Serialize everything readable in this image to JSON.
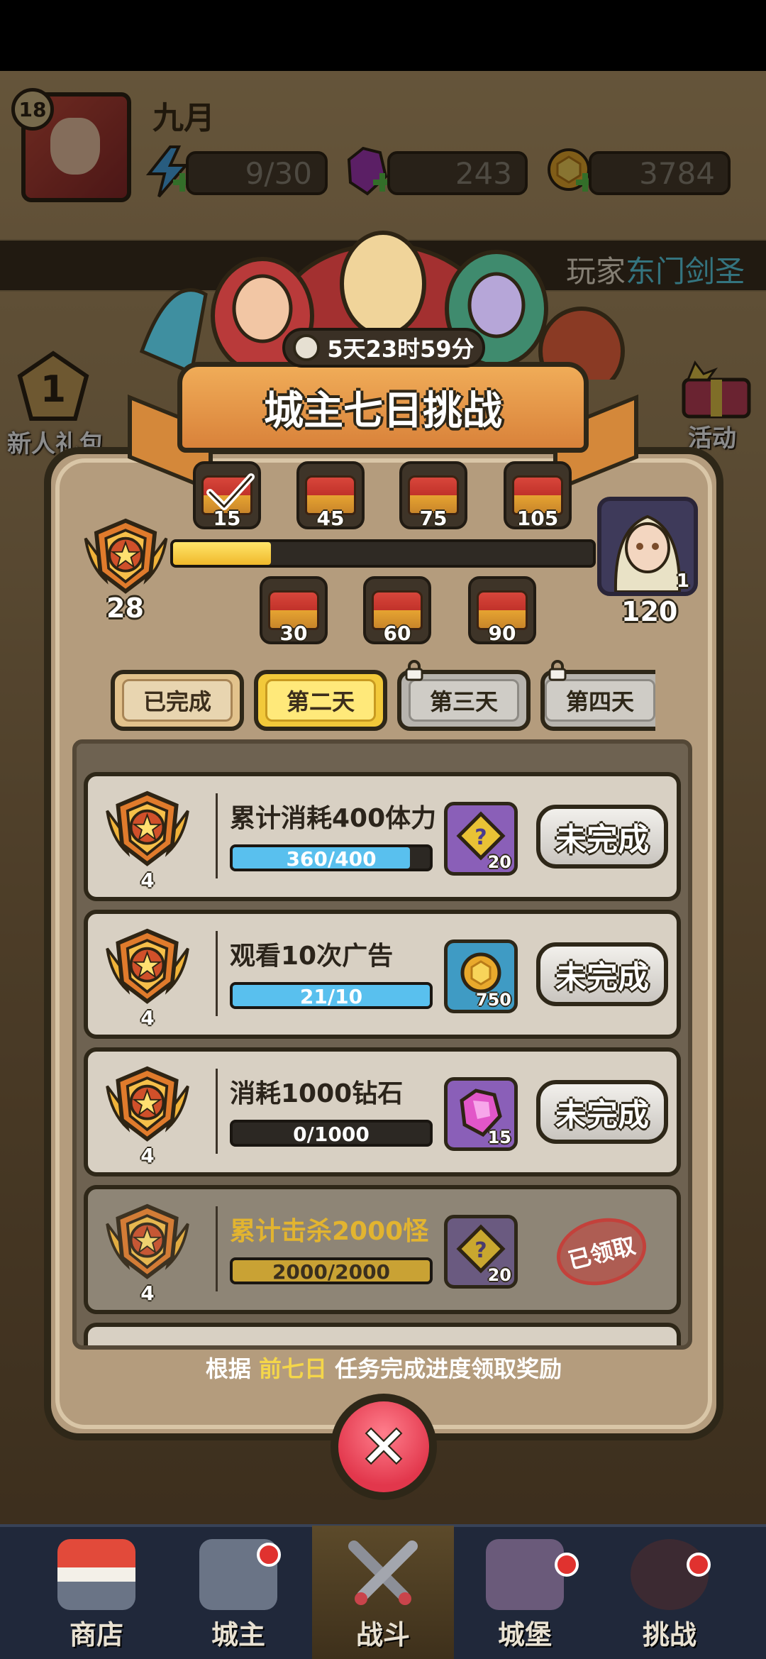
{
  "player": {
    "name": "九月",
    "level": "18"
  },
  "resources": {
    "energy": "9/30",
    "gems": "243",
    "gold": "3784"
  },
  "marquee": {
    "prefix": "玩家",
    "highlight": "东门剑圣"
  },
  "side_left": [
    {
      "label": "新人礼包",
      "badge": "1"
    }
  ],
  "side_right": [
    {
      "label": "活动"
    }
  ],
  "modal": {
    "timer": "5天23时59分",
    "title": "城主七日挑战",
    "score_current": "28",
    "score_max": "120",
    "final_reward_count": "1",
    "progress": {
      "current": 28,
      "max": 120
    },
    "chests_top": [
      {
        "label": "15",
        "claimed": true
      },
      {
        "label": "45",
        "claimed": false
      },
      {
        "label": "75",
        "claimed": false
      },
      {
        "label": "105",
        "claimed": false
      }
    ],
    "chests_bottom": [
      {
        "label": "30"
      },
      {
        "label": "60"
      },
      {
        "label": "90"
      }
    ],
    "tabs": [
      {
        "label": "已完成",
        "state": "normal"
      },
      {
        "label": "第二天",
        "state": "active"
      },
      {
        "label": "第三天",
        "state": "locked"
      },
      {
        "label": "第四天",
        "state": "locked"
      }
    ],
    "tasks": [
      {
        "title": "累计消耗400体力",
        "progress_text": "360/400",
        "progress": 0.9,
        "medal": "4",
        "reward_type": "puzzle",
        "reward_count": "20",
        "status": "未完成"
      },
      {
        "title": "观看10次广告",
        "progress_text": "21/10",
        "progress": 1.0,
        "medal": "4",
        "reward_type": "gold",
        "reward_count": "750",
        "status": "未完成"
      },
      {
        "title": "消耗1000钻石",
        "progress_text": "0/1000",
        "progress": 0.0,
        "medal": "4",
        "reward_type": "gem",
        "reward_count": "15",
        "status": "未完成"
      },
      {
        "title": "累计击杀2000怪",
        "progress_text": "2000/2000",
        "progress": 1.0,
        "medal": "4",
        "reward_type": "puzzle",
        "reward_count": "20",
        "status": "已领取"
      }
    ],
    "hint": {
      "before": "根据",
      "highlight": "前七日",
      "after": "任务完成进度领取奖励"
    }
  },
  "bottom_nav": [
    {
      "label": "商店",
      "active": false,
      "dot": false
    },
    {
      "label": "城主",
      "active": false,
      "dot": true
    },
    {
      "label": "战斗",
      "active": true,
      "dot": false
    },
    {
      "label": "城堡",
      "active": false,
      "dot": true
    },
    {
      "label": "挑战",
      "active": false,
      "dot": true
    }
  ],
  "colors": {
    "accent_yellow": "#f4d64a",
    "marquee_highlight": "#5fd3e8",
    "close_red": "#e2374c",
    "progress_blue": "#59c0ee"
  }
}
